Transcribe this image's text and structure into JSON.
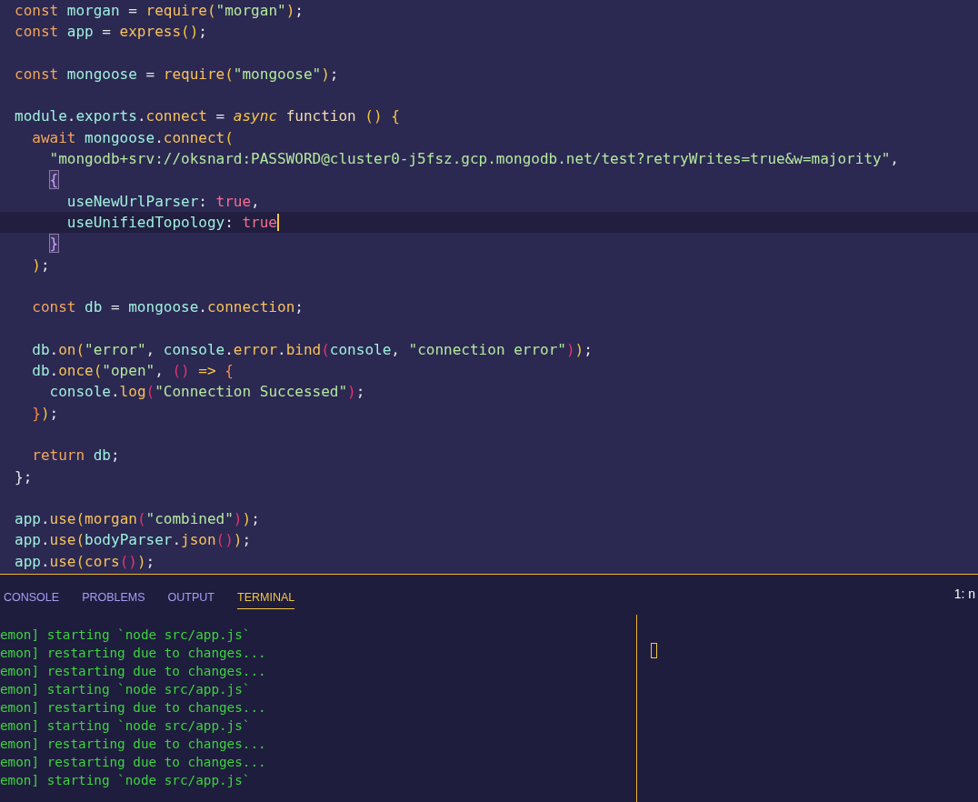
{
  "editor": {
    "lines": [
      {
        "tokens": [
          {
            "kind": "keyword",
            "text": "const "
          },
          {
            "kind": "identifier",
            "text": "morgan "
          },
          {
            "kind": "punct",
            "text": "= "
          },
          {
            "kind": "function",
            "text": "require"
          },
          {
            "kind": "paren",
            "text": "("
          },
          {
            "kind": "string",
            "text": "\"morgan\""
          },
          {
            "kind": "paren",
            "text": ")"
          },
          {
            "kind": "punct",
            "text": ";"
          }
        ]
      },
      {
        "gap_after": true,
        "tokens": [
          {
            "kind": "keyword",
            "text": "const "
          },
          {
            "kind": "identifier",
            "text": "app "
          },
          {
            "kind": "punct",
            "text": "= "
          },
          {
            "kind": "function",
            "text": "express"
          },
          {
            "kind": "paren",
            "text": "()"
          },
          {
            "kind": "punct",
            "text": ";"
          }
        ]
      },
      {
        "gap_after": true,
        "tokens": [
          {
            "kind": "keyword",
            "text": "const "
          },
          {
            "kind": "identifier",
            "text": "mongoose "
          },
          {
            "kind": "punct",
            "text": "= "
          },
          {
            "kind": "function",
            "text": "require"
          },
          {
            "kind": "paren",
            "text": "("
          },
          {
            "kind": "string",
            "text": "\"mongoose\""
          },
          {
            "kind": "paren",
            "text": ")"
          },
          {
            "kind": "punct",
            "text": ";"
          }
        ]
      },
      {
        "tokens": [
          {
            "kind": "identifier",
            "text": "module"
          },
          {
            "kind": "punct",
            "text": "."
          },
          {
            "kind": "identifier",
            "text": "exports"
          },
          {
            "kind": "punct",
            "text": "."
          },
          {
            "kind": "function",
            "text": "connect "
          },
          {
            "kind": "punct",
            "text": "= "
          },
          {
            "kind": "modifier",
            "text": "async "
          },
          {
            "kind": "storage",
            "text": "function "
          },
          {
            "kind": "paren",
            "text": "() {"
          }
        ]
      },
      {
        "tokens": [
          {
            "kind": "keyword",
            "text": "  await "
          },
          {
            "kind": "identifier",
            "text": "mongoose"
          },
          {
            "kind": "punct",
            "text": "."
          },
          {
            "kind": "function",
            "text": "connect"
          },
          {
            "kind": "paren",
            "text": "("
          }
        ]
      },
      {
        "tokens": [
          {
            "kind": "string",
            "text": "    \"mongodb+srv://oksnard:PASSWORD@cluster0-j5fsz.gcp.mongodb.net/test?retryWrites=true&w=majority\""
          },
          {
            "kind": "punct",
            "text": ","
          }
        ]
      },
      {
        "tokens": [
          {
            "kind": "matched",
            "text": "    {"
          }
        ]
      },
      {
        "tokens": [
          {
            "kind": "identifier",
            "text": "      useNewUrlParser"
          },
          {
            "kind": "punct",
            "text": ": "
          },
          {
            "kind": "boolean",
            "text": "true"
          },
          {
            "kind": "punct",
            "text": ","
          }
        ]
      },
      {
        "current": true,
        "tokens": [
          {
            "kind": "identifier",
            "text": "      useUnifiedTopology"
          },
          {
            "kind": "punct",
            "text": ": "
          },
          {
            "kind": "boolean",
            "text": "true"
          }
        ]
      },
      {
        "tokens": [
          {
            "kind": "matched",
            "text": "    }"
          }
        ]
      },
      {
        "gap_after": true,
        "tokens": [
          {
            "kind": "paren",
            "text": "  )"
          },
          {
            "kind": "punct",
            "text": ";"
          }
        ]
      },
      {
        "gap_after": true,
        "tokens": [
          {
            "kind": "keyword",
            "text": "  const "
          },
          {
            "kind": "identifier",
            "text": "db "
          },
          {
            "kind": "punct",
            "text": "= "
          },
          {
            "kind": "identifier",
            "text": "mongoose"
          },
          {
            "kind": "punct",
            "text": "."
          },
          {
            "kind": "function",
            "text": "connection"
          },
          {
            "kind": "punct",
            "text": ";"
          }
        ]
      },
      {
        "tokens": [
          {
            "kind": "identifier",
            "text": "  db"
          },
          {
            "kind": "punct",
            "text": "."
          },
          {
            "kind": "function",
            "text": "on"
          },
          {
            "kind": "paren",
            "text": "("
          },
          {
            "kind": "string",
            "text": "\"error\""
          },
          {
            "kind": "punct",
            "text": ", "
          },
          {
            "kind": "identifier",
            "text": "console"
          },
          {
            "kind": "punct",
            "text": "."
          },
          {
            "kind": "function",
            "text": "error"
          },
          {
            "kind": "punct",
            "text": "."
          },
          {
            "kind": "function",
            "text": "bind"
          },
          {
            "kind": "paren2",
            "text": "("
          },
          {
            "kind": "identifier",
            "text": "console"
          },
          {
            "kind": "punct",
            "text": ", "
          },
          {
            "kind": "string",
            "text": "\"connection error\""
          },
          {
            "kind": "paren2",
            "text": ")"
          },
          {
            "kind": "paren",
            "text": ")"
          },
          {
            "kind": "punct",
            "text": ";"
          }
        ]
      },
      {
        "tokens": [
          {
            "kind": "identifier",
            "text": "  db"
          },
          {
            "kind": "punct",
            "text": "."
          },
          {
            "kind": "function",
            "text": "once"
          },
          {
            "kind": "paren",
            "text": "("
          },
          {
            "kind": "string",
            "text": "\"open\""
          },
          {
            "kind": "punct",
            "text": ", "
          },
          {
            "kind": "paren2",
            "text": "() "
          },
          {
            "kind": "paren",
            "text": "=> "
          },
          {
            "kind": "brace",
            "text": "{"
          }
        ]
      },
      {
        "tokens": [
          {
            "kind": "identifier",
            "text": "    console"
          },
          {
            "kind": "punct",
            "text": "."
          },
          {
            "kind": "function",
            "text": "log"
          },
          {
            "kind": "paren2",
            "text": "("
          },
          {
            "kind": "string",
            "text": "\"Connection Successed\""
          },
          {
            "kind": "paren2",
            "text": ")"
          },
          {
            "kind": "punct",
            "text": ";"
          }
        ]
      },
      {
        "gap_after": true,
        "tokens": [
          {
            "kind": "brace",
            "text": "  }"
          },
          {
            "kind": "paren",
            "text": ")"
          },
          {
            "kind": "punct",
            "text": ";"
          }
        ]
      },
      {
        "tokens": [
          {
            "kind": "keyword",
            "text": "  return "
          },
          {
            "kind": "identifier",
            "text": "db"
          },
          {
            "kind": "punct",
            "text": ";"
          }
        ]
      },
      {
        "gap_after": true,
        "tokens": [
          {
            "kind": "punct",
            "text": "};"
          }
        ]
      },
      {
        "tokens": [
          {
            "kind": "identifier",
            "text": "app"
          },
          {
            "kind": "punct",
            "text": "."
          },
          {
            "kind": "function",
            "text": "use"
          },
          {
            "kind": "paren",
            "text": "("
          },
          {
            "kind": "function",
            "text": "morgan"
          },
          {
            "kind": "paren2",
            "text": "("
          },
          {
            "kind": "string",
            "text": "\"combined\""
          },
          {
            "kind": "paren2",
            "text": ")"
          },
          {
            "kind": "paren",
            "text": ")"
          },
          {
            "kind": "punct",
            "text": ";"
          }
        ]
      },
      {
        "tokens": [
          {
            "kind": "identifier",
            "text": "app"
          },
          {
            "kind": "punct",
            "text": "."
          },
          {
            "kind": "function",
            "text": "use"
          },
          {
            "kind": "paren",
            "text": "("
          },
          {
            "kind": "identifier",
            "text": "bodyParser"
          },
          {
            "kind": "punct",
            "text": "."
          },
          {
            "kind": "function",
            "text": "json"
          },
          {
            "kind": "paren2",
            "text": "()"
          },
          {
            "kind": "paren",
            "text": ")"
          },
          {
            "kind": "punct",
            "text": ";"
          }
        ]
      },
      {
        "tokens": [
          {
            "kind": "identifier",
            "text": "app"
          },
          {
            "kind": "punct",
            "text": "."
          },
          {
            "kind": "function",
            "text": "use"
          },
          {
            "kind": "paren",
            "text": "("
          },
          {
            "kind": "function",
            "text": "cors"
          },
          {
            "kind": "paren2",
            "text": "()"
          },
          {
            "kind": "paren",
            "text": ")"
          },
          {
            "kind": "punct",
            "text": ";"
          }
        ]
      }
    ]
  },
  "panel": {
    "tabs": [
      {
        "label": "CONSOLE",
        "selected": false
      },
      {
        "label": "PROBLEMS",
        "selected": false
      },
      {
        "label": "OUTPUT",
        "selected": false
      },
      {
        "label": "TERMINAL",
        "selected": true
      }
    ],
    "terminal_selector": "1: n",
    "terminal_lines": [
      "emon] starting `node src/app.js`",
      "emon] restarting due to changes...",
      "emon] restarting due to changes...",
      "emon] starting `node src/app.js`",
      "emon] restarting due to changes...",
      "emon] starting `node src/app.js`",
      "emon] restarting due to changes...",
      "emon] restarting due to changes...",
      "emon] starting `node src/app.js`"
    ]
  }
}
